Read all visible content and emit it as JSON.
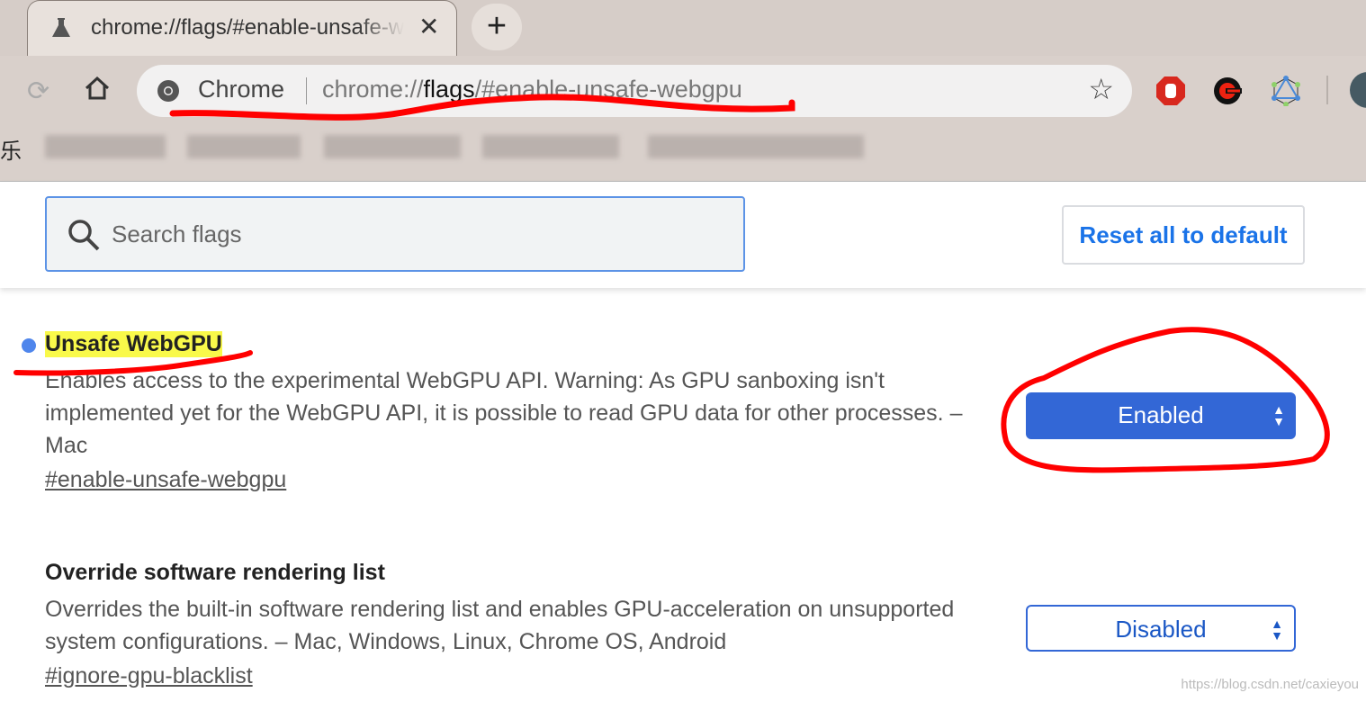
{
  "tab": {
    "title": "chrome://flags/#enable-unsafe-webgpu",
    "close": "✕",
    "new_tab": "+"
  },
  "omnibox": {
    "site_label": "Chrome",
    "url_prefix": "chrome://",
    "url_bold": "flags",
    "url_suffix": "/#enable-unsafe-webgpu"
  },
  "extensions": [
    "adblock-icon",
    "power-extension-icon",
    "graphql-icon"
  ],
  "bookmarks": {
    "leading_char": "乐"
  },
  "search": {
    "placeholder": "Search flags",
    "value": ""
  },
  "reset_label": "Reset all to default",
  "flags": [
    {
      "name": "Unsafe WebGPU",
      "description": "Enables access to the experimental WebGPU API. Warning: As GPU sanboxing isn't implemented yet for the WebGPU API, it is possible to read GPU data for other processes. – Mac",
      "anchor": "#enable-unsafe-webgpu",
      "value": "Enabled",
      "highlighted": true
    },
    {
      "name": "Override software rendering list",
      "description": "Overrides the built-in software rendering list and enables GPU-acceleration on unsupported system configurations. – Mac, Windows, Linux, Chrome OS, Android",
      "anchor": "#ignore-gpu-blacklist",
      "value": "Disabled"
    }
  ],
  "watermark": "https://blog.csdn.net/caxieyou",
  "colors": {
    "accent": "#3367d6",
    "highlight": "#f9f94a",
    "annotation": "#ff0000"
  }
}
